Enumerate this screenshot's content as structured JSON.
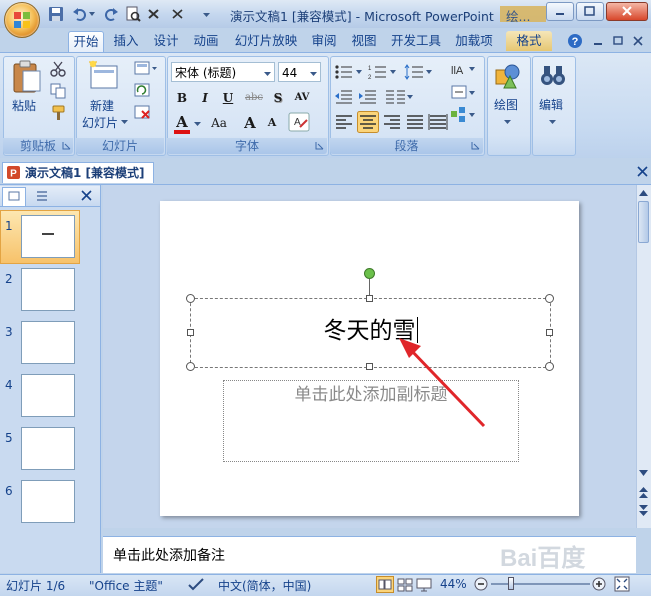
{
  "window": {
    "title": "演示文稿1 [兼容模式] - Microsoft PowerPoint",
    "context_tab_group": "绘..."
  },
  "quick_access": [
    "save-icon",
    "undo-icon",
    "redo-icon",
    "print-preview-icon",
    "customize-icon"
  ],
  "ribbon": {
    "tabs": [
      {
        "label": "开始",
        "active": true
      },
      {
        "label": "插入"
      },
      {
        "label": "设计"
      },
      {
        "label": "动画"
      },
      {
        "label": "幻灯片放映"
      },
      {
        "label": "审阅"
      },
      {
        "label": "视图"
      },
      {
        "label": "开发工具"
      },
      {
        "label": "加载项"
      },
      {
        "label": "格式"
      }
    ],
    "groups": {
      "clipboard": {
        "label": "剪贴板",
        "paste": "粘贴"
      },
      "slides": {
        "label": "幻灯片",
        "new_slide_line1": "新建",
        "new_slide_line2": "幻灯片"
      },
      "font": {
        "label": "字体",
        "font_name": "宋体 (标题)",
        "font_size": "44",
        "bold": "B",
        "italic": "I",
        "underline": "U",
        "strike": "abc",
        "shadow": "S",
        "spacing": "AV",
        "font_color": "A",
        "change_case": "Aa",
        "grow": "A",
        "shrink": "A"
      },
      "paragraph": {
        "label": "段落"
      },
      "drawing": {
        "label": "绘图"
      },
      "editing": {
        "label": "编辑"
      }
    }
  },
  "document_tab": "演示文稿1 [兼容模式]",
  "slides": [
    {
      "number": "1",
      "selected": true
    },
    {
      "number": "2"
    },
    {
      "number": "3"
    },
    {
      "number": "4"
    },
    {
      "number": "5"
    },
    {
      "number": "6"
    }
  ],
  "slide": {
    "title_text": "冬天的雪",
    "subtitle_placeholder": "单击此处添加副标题"
  },
  "notes_placeholder": "单击此处添加备注",
  "status": {
    "slide_counter": "幻灯片 1/6",
    "theme": "\"Office 主题\"",
    "language": "中文(简体，中国)",
    "zoom": "44%"
  },
  "colors": {
    "accent": "#15428b",
    "arrow": "#e0262a",
    "selected_thumb": "#f7c26a"
  }
}
